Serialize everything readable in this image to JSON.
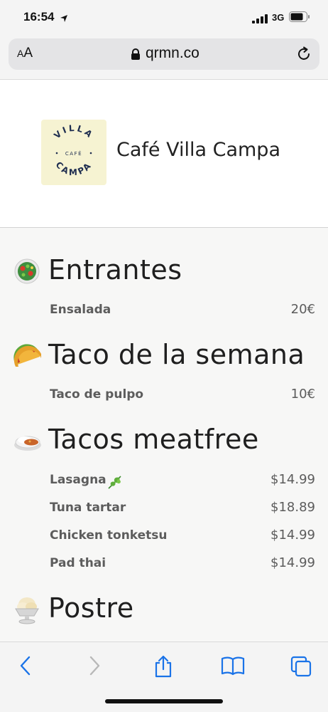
{
  "status_bar": {
    "time": "16:54",
    "network": "3G"
  },
  "browser": {
    "url": "qrmn.co",
    "text_size_label_small": "A",
    "text_size_label_large": "A"
  },
  "header": {
    "cafe_name": "Café Villa Campa",
    "logo_text_top": "VILLA",
    "logo_text_middle": "CAFÉ",
    "logo_text_bottom": "CAMPA"
  },
  "menu": {
    "sections": [
      {
        "title": "Entrantes",
        "icon": "salad-icon",
        "items": [
          {
            "name": "Ensalada",
            "price": "20€"
          }
        ]
      },
      {
        "title": "Taco de la semana",
        "icon": "taco-icon",
        "items": [
          {
            "name": "Taco de pulpo",
            "price": "10€"
          }
        ]
      },
      {
        "title": "Tacos meatfree",
        "icon": "curry-rice-icon",
        "items": [
          {
            "name": "Lasagna",
            "price": "$14.99",
            "tag_icon": "herb-icon"
          },
          {
            "name": "Tuna tartar",
            "price": "$18.89"
          },
          {
            "name": "Chicken tonketsu",
            "price": "$14.99"
          },
          {
            "name": "Pad thai",
            "price": "$14.99"
          }
        ]
      },
      {
        "title": "Postre",
        "icon": "ice-cream-icon",
        "items": []
      }
    ]
  },
  "toolbar_icons": [
    "back-icon",
    "forward-icon",
    "share-icon",
    "bookmarks-icon",
    "tabs-icon"
  ],
  "colors": {
    "accent": "#1a73e8",
    "disabled": "#b8b8b8",
    "logo_bg": "#f6f3d2",
    "logo_ink": "#1e2d4f"
  }
}
